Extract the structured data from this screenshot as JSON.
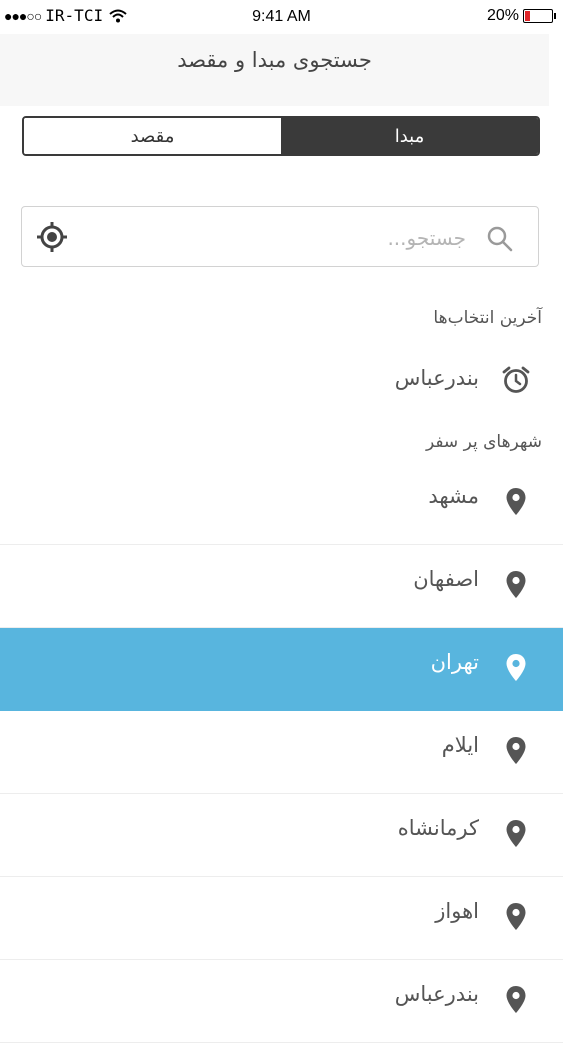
{
  "status_bar": {
    "signal_dots": "●●●○○",
    "carrier": "IR-TCI",
    "time": "9:41 AM",
    "battery_percent": "20%",
    "battery_level": 0.2,
    "battery_color": "#e0262a"
  },
  "header": {
    "title": "جستجوی مبدا و مقصد"
  },
  "segment": {
    "origin_label": "مبدا",
    "destination_label": "مقصد",
    "selected": "origin"
  },
  "search": {
    "placeholder": "جستجو...",
    "value": ""
  },
  "recent": {
    "title": "آخرین انتخاب‌ها",
    "items": [
      {
        "label": "بندرعباس",
        "icon": "alarm-clock-icon"
      }
    ]
  },
  "popular": {
    "title": "شهرهای پر سفر",
    "items": [
      {
        "label": "مشهد",
        "icon": "map-pin-icon"
      },
      {
        "label": "اصفهان",
        "icon": "map-pin-icon"
      },
      {
        "label": "تهران",
        "icon": "map-pin-icon",
        "selected": true
      },
      {
        "label": "ایلام",
        "icon": "map-pin-icon"
      },
      {
        "label": "کرمانشاه",
        "icon": "map-pin-icon"
      },
      {
        "label": "اهواز",
        "icon": "map-pin-icon"
      },
      {
        "label": "بندرعباس",
        "icon": "map-pin-icon"
      }
    ]
  },
  "colors": {
    "accent": "#58b5de",
    "segment_dark": "#3a3a3a",
    "icon_gray": "#555555"
  }
}
